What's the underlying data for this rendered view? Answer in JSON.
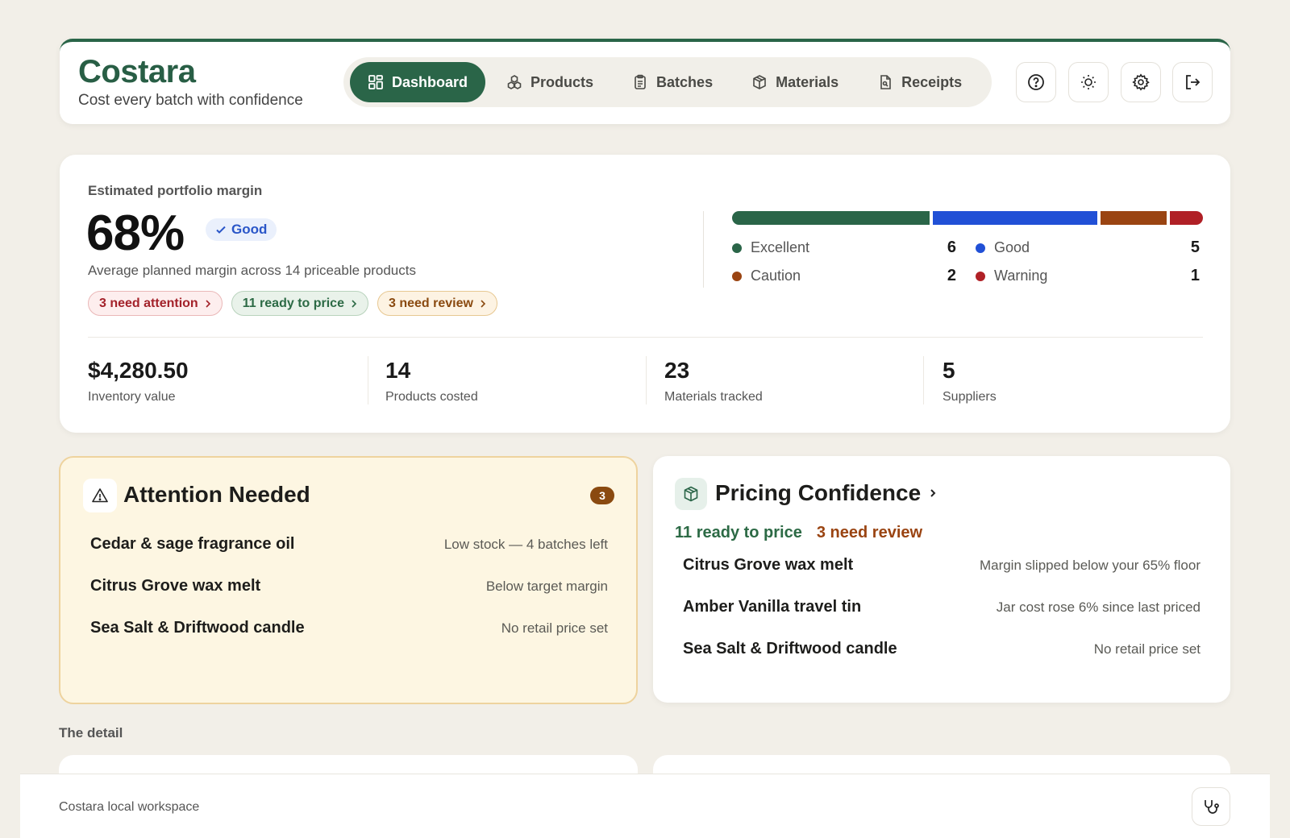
{
  "brand": {
    "title": "Costara",
    "subtitle": "Cost every batch with confidence"
  },
  "nav": {
    "items": [
      {
        "label": "Dashboard",
        "icon": "grid-icon",
        "active": true
      },
      {
        "label": "Products",
        "icon": "shapes-icon"
      },
      {
        "label": "Batches",
        "icon": "clipboard-icon"
      },
      {
        "label": "Materials",
        "icon": "package-icon"
      },
      {
        "label": "Receipts",
        "icon": "file-icon"
      }
    ]
  },
  "header_actions": [
    "help-icon",
    "sun-icon",
    "gear-icon",
    "logout-icon"
  ],
  "summary": {
    "label": "Estimated portfolio margin",
    "margin": "68%",
    "status": "Good",
    "description": "Average planned margin across 14 priceable products",
    "chips": [
      {
        "label": "3 need attention",
        "tone": "red"
      },
      {
        "label": "11 ready to price",
        "tone": "green"
      },
      {
        "label": "3 need review",
        "tone": "amber"
      }
    ],
    "distribution": [
      {
        "label": "Excellent",
        "count": "6",
        "value": 6,
        "color": "#2a6548"
      },
      {
        "label": "Good",
        "count": "5",
        "value": 5,
        "color": "#2150d6"
      },
      {
        "label": "Caution",
        "count": "2",
        "value": 2,
        "color": "#9a4412"
      },
      {
        "label": "Warning",
        "count": "1",
        "value": 1,
        "color": "#b02026"
      }
    ],
    "stats": [
      {
        "value": "$4,280.50",
        "label": "Inventory value"
      },
      {
        "value": "14",
        "label": "Products costed"
      },
      {
        "value": "23",
        "label": "Materials tracked"
      },
      {
        "value": "5",
        "label": "Suppliers"
      }
    ]
  },
  "attention": {
    "title": "Attention Needed",
    "count": "3",
    "items": [
      {
        "name": "Cedar & sage fragrance oil",
        "note": "Low stock — 4 batches left"
      },
      {
        "name": "Citrus Grove wax melt",
        "note": "Below target margin"
      },
      {
        "name": "Sea Salt & Driftwood candle",
        "note": "No retail price set"
      }
    ]
  },
  "pricing": {
    "title": "Pricing Confidence",
    "ready": "11 ready to price",
    "review": "3 need review",
    "items": [
      {
        "name": "Citrus Grove wax melt",
        "note": "Margin slipped below your 65% floor"
      },
      {
        "name": "Amber Vanilla travel tin",
        "note": "Jar cost rose 6% since last priced"
      },
      {
        "name": "Sea Salt & Driftwood candle",
        "note": "No retail price set"
      }
    ]
  },
  "detail": {
    "label": "The detail"
  },
  "footer": {
    "text": "Costara local workspace",
    "icon": "stethoscope-icon"
  },
  "colors": {
    "brand": "#2a6548",
    "background": "#f2efe8",
    "attention_bg": "#fdf6e2"
  }
}
